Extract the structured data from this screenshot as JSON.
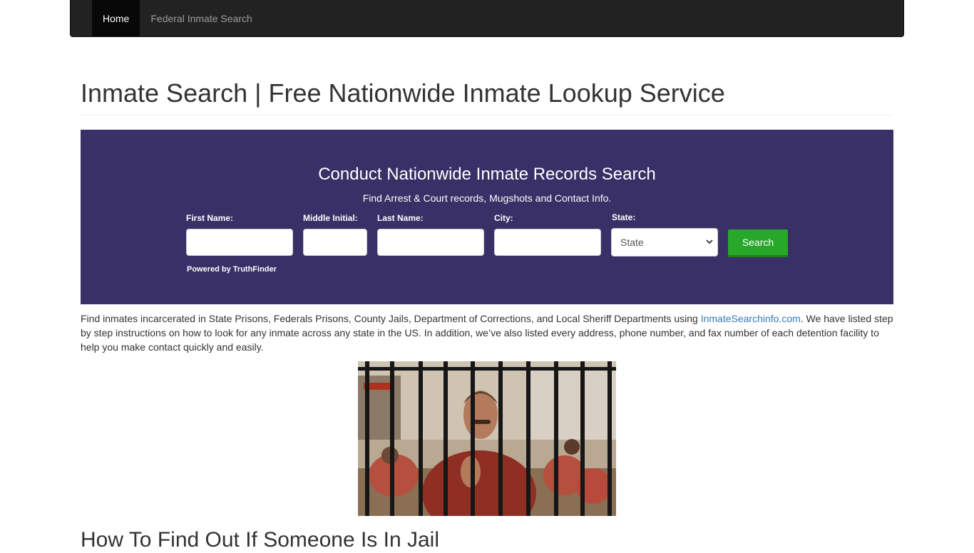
{
  "nav": {
    "home_label": "Home",
    "federal_label": "Federal Inmate Search"
  },
  "page": {
    "title": "Inmate Search | Free Nationwide Inmate Lookup Service"
  },
  "search_panel": {
    "heading": "Conduct Nationwide Inmate Records Search",
    "subheading": "Find Arrest & Court records, Mugshots and Contact Info.",
    "fields": {
      "first_name_label": "First Name:",
      "middle_initial_label": "Middle Initial:",
      "last_name_label": "Last Name:",
      "city_label": "City:",
      "state_label": "State:",
      "first_name_value": "",
      "middle_initial_value": "",
      "last_name_value": "",
      "city_value": "",
      "state_selected": "State"
    },
    "search_button": "Search",
    "powered_by": "Powered by TruthFinder",
    "colors": {
      "panel_bg": "#383066",
      "button_bg": "#28a82b"
    }
  },
  "intro": {
    "text_before_link": "Find inmates incarcerated in State Prisons, Federals Prisons, County Jails, Department of Corrections, and Local Sheriff Departments using ",
    "link_text": "InmateSearchinfo.com",
    "text_after_link": ". We have listed step by step instructions on how to look for any inmate across any state in the US. In addition, we’ve also listed every address, phone number, and fax number of each detention facility to help you make contact quickly and easily."
  },
  "section": {
    "heading": "How To Find Out If Someone Is In Jail"
  }
}
